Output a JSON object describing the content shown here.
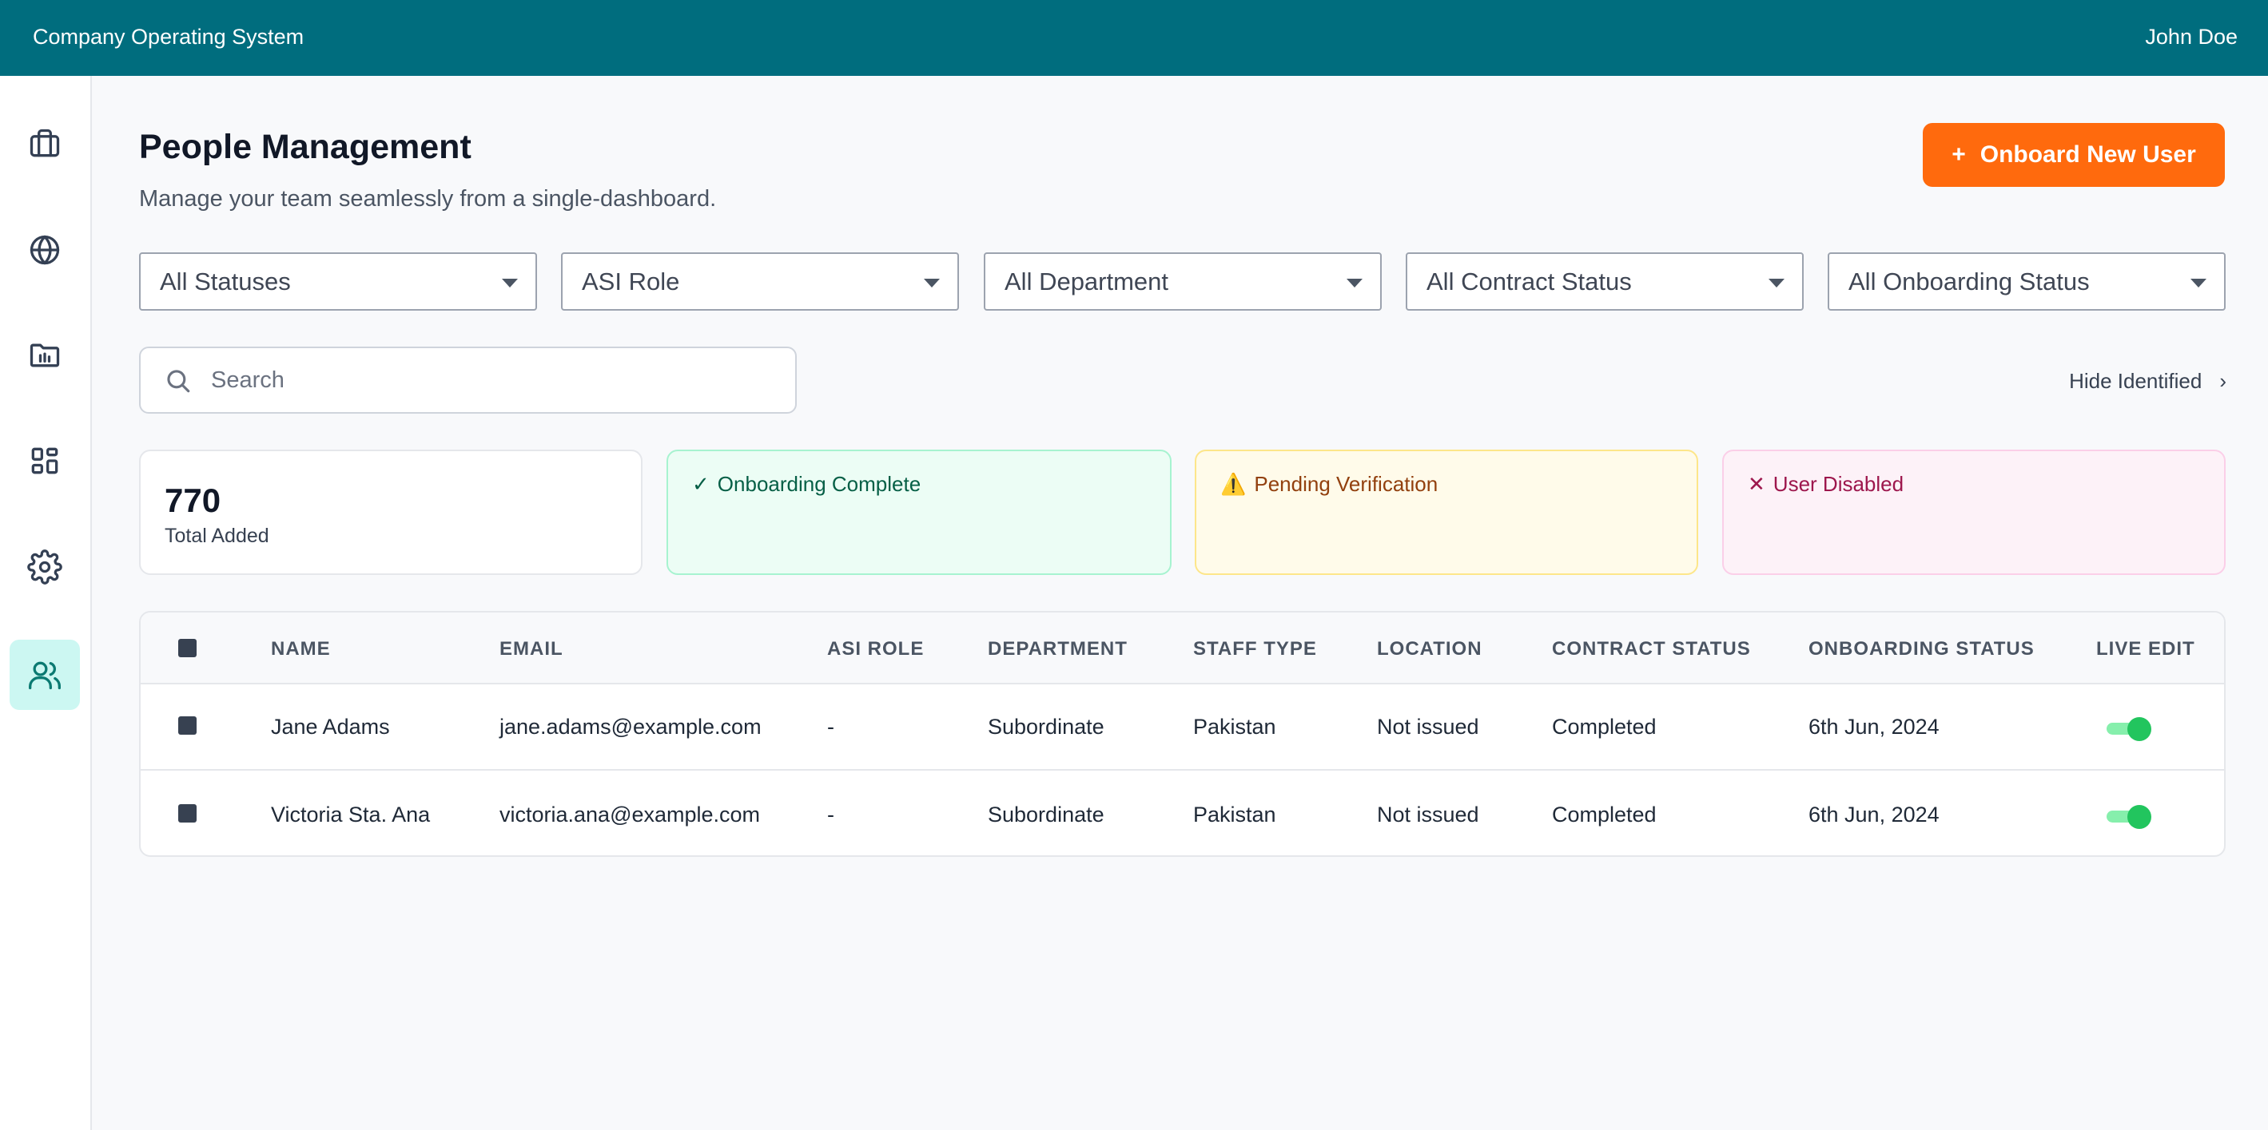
{
  "header": {
    "app_title": "Company Operating System",
    "user_name": "John Doe"
  },
  "sidebar": {
    "items": [
      {
        "icon": "briefcase-icon",
        "active": false
      },
      {
        "icon": "globe-icon",
        "active": false
      },
      {
        "icon": "folder-chart-icon",
        "active": false
      },
      {
        "icon": "dashboard-grid-icon",
        "active": false
      },
      {
        "icon": "gear-icon",
        "active": false
      },
      {
        "icon": "users-icon",
        "active": true
      }
    ]
  },
  "page": {
    "title": "People Management",
    "subtitle": "Manage your team seamlessly from a single-dashboard.",
    "onboard_button": {
      "icon": "+",
      "label": "Onboard New User"
    }
  },
  "filters": [
    "All Statuses",
    "ASI Role",
    "All Department",
    "All Contract Status",
    "All Onboarding Status"
  ],
  "search": {
    "placeholder": "Search",
    "value": ""
  },
  "hide_identified": {
    "label": "Hide Identified",
    "chevron": "›"
  },
  "stats": {
    "total": {
      "value": "770",
      "label": "Total Added"
    },
    "complete": {
      "icon": "✓",
      "label": "Onboarding Complete",
      "color": "#065f46"
    },
    "pending": {
      "icon": "⚠️",
      "label": "Pending Verification",
      "color": "#92400e"
    },
    "disabled": {
      "icon": "✕",
      "label": "User Disabled",
      "color": "#9d174d"
    }
  },
  "table": {
    "columns": [
      "NAME",
      "EMAIL",
      "ASI ROLE",
      "DEPARTMENT",
      "STAFF TYPE",
      "LOCATION",
      "CONTRACT STATUS",
      "ONBOARDING STATUS",
      "LIVE EDIT"
    ],
    "rows": [
      {
        "name": "Jane Adams",
        "email": "jane.adams@example.com",
        "asi_role": "-",
        "department": "Subordinate",
        "staff_type": "Pakistan",
        "location": "Not issued",
        "contract_status": "Completed",
        "onboarding_status": "6th Jun, 2024",
        "live_edit": true
      },
      {
        "name": "Victoria Sta. Ana",
        "email": "victoria.ana@example.com",
        "asi_role": "-",
        "department": "Subordinate",
        "staff_type": "Pakistan",
        "location": "Not issued",
        "contract_status": "Completed",
        "onboarding_status": "6th Jun, 2024",
        "live_edit": true
      }
    ]
  },
  "colors": {
    "topbar": "#006d7e",
    "accent_button": "#ff6a0d",
    "active_nav": "#ccf7f2",
    "toggle_on": "#22c55e"
  }
}
